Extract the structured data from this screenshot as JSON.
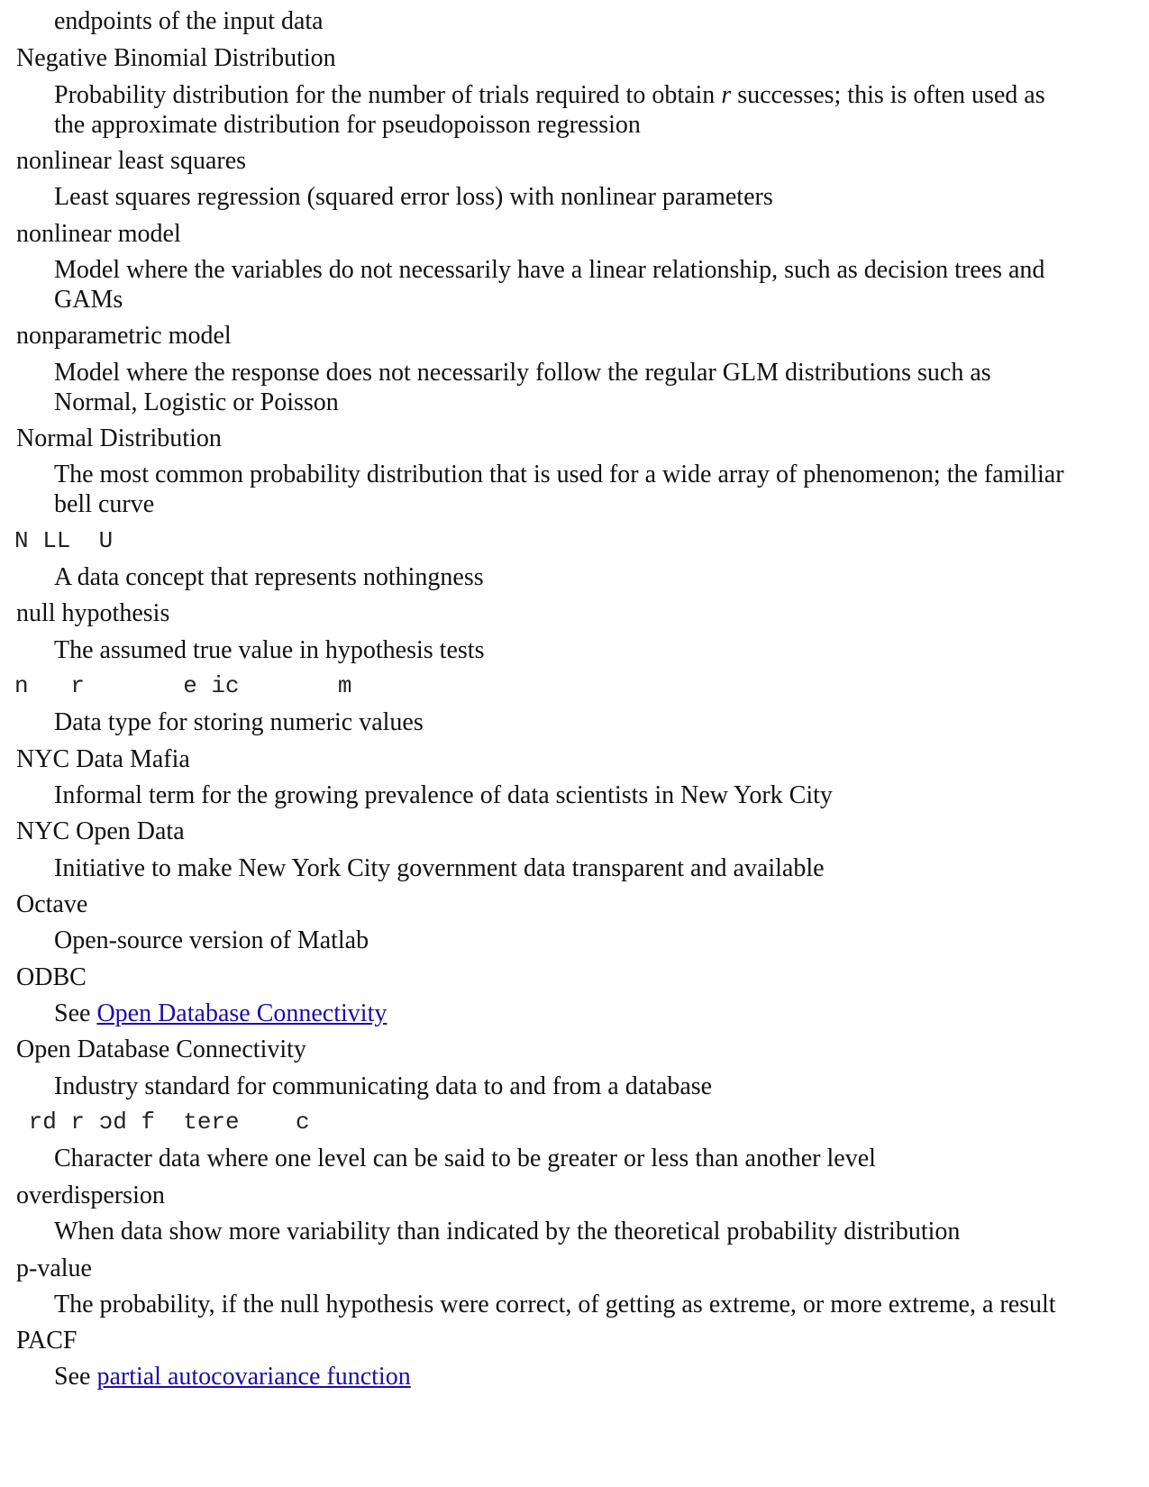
{
  "entries": [
    {
      "def": [
        "endpoints of the input data"
      ]
    },
    {
      "term": "Negative Binomial Distribution"
    },
    {
      "def_parts": [
        "Probability distribution for the number of trials required to obtain ",
        "r",
        " successes; this is often used as"
      ],
      "def2": "the approximate distribution for pseudopoisson regression"
    },
    {
      "term": "nonlinear least squares",
      "def": "Least squares regression (squared error loss) with nonlinear parameters"
    },
    {
      "term": "nonlinear model",
      "def1": "Model where the variables do not necessarily have a linear relationship, such as decision trees and",
      "def2": "GAMs"
    },
    {
      "term": "nonparametric model",
      "def1": "Model where the response does not necessarily follow the regular GLM distributions such as",
      "def2": "Normal, Logistic or Poisson"
    },
    {
      "term": "Normal Distribution",
      "def1": "The most common probability distribution that is used for a wide array of phenomenon; the familiar",
      "def2": "bell curve"
    },
    {
      "term": "N LL  U",
      "def": "A data concept that represents nothingness"
    },
    {
      "term": "null hypothesis",
      "def": "The assumed true value in hypothesis tests"
    },
    {
      "term": "n   r       e ic       m",
      "def": "Data type for storing numeric values"
    },
    {
      "term": "NYC Data Mafia",
      "def": "Informal term for the growing prevalence of data scientists in New York City"
    },
    {
      "term": "NYC Open Data",
      "def": "Initiative to make New York City government data transparent and available"
    },
    {
      "term": "Octave",
      "def": "Open-source version of Matlab"
    },
    {
      "term": "ODBC",
      "def_prefix": "See ",
      "def_link": "Open Database Connectivity"
    },
    {
      "term": "Open Database Connectivity",
      "def": "Industry standard for communicating data to and from a database"
    },
    {
      "term": "rd r ɔd f  tere    c",
      "def": "Character data where one level can be said to be greater or less than another level"
    },
    {
      "term": "overdispersion",
      "def": "When data show more variability than indicated by the theoretical probability distribution"
    },
    {
      "term": "p-value",
      "def": "The probability, if the null hypothesis were correct, of getting as extreme, or more extreme, a result"
    },
    {
      "term": "PACF",
      "def_prefix": "See ",
      "def_link": "partial autocovariance function"
    }
  ],
  "t": {
    "l0": "endpoints of the input data",
    "l1": "Negative Binomial Distribution",
    "l2a": "Probability distribution for the number of trials required to obtain ",
    "l2b": "r",
    "l2c": " successes; this is often used as",
    "l3": "the approximate distribution for pseudopoisson regression",
    "l4": "nonlinear least squares",
    "l5": "Least squares regression (squared error loss) with nonlinear parameters",
    "l6": "nonlinear model",
    "l7": "Model where the variables do not necessarily have a linear relationship, such as decision trees and",
    "l8": "GAMs",
    "l9": "nonparametric model",
    "l10": "Model where the response does not necessarily follow the regular GLM distributions such as",
    "l11": "Normal, Logistic or Poisson",
    "l12": "Normal Distribution",
    "l13": "The most common probability distribution that is used for a wide array of phenomenon; the familiar",
    "l14": "bell curve",
    "l15": "N LL  U",
    "l16": "A data concept that represents nothingness",
    "l17": "null hypothesis",
    "l18": "The assumed true value in hypothesis tests",
    "l19": "n   r       e ic       m",
    "l20": "Data type for storing numeric values",
    "l21": "NYC Data Mafia",
    "l22": "Informal term for the growing prevalence of data scientists in New York City",
    "l23": "NYC Open Data",
    "l24": "Initiative to make New York City government data transparent and available",
    "l25": "Octave",
    "l26": "Open-source version of Matlab",
    "l27": "ODBC",
    "l28a": "See ",
    "l28b": "Open Database Connectivity",
    "l29": "Open Database Connectivity",
    "l30": "Industry standard for communicating data to and from a database",
    "l31": " rd r ɔd f  tere    c",
    "l32": "Character data where one level can be said to be greater or less than another level",
    "l33": "overdispersion",
    "l34": "When data show more variability than indicated by the theoretical probability distribution",
    "l35": "p-value",
    "l36": "The probability, if the null hypothesis were correct, of getting as extreme, or more extreme, a result",
    "l37": "PACF",
    "l38a": "See ",
    "l38b": "partial autocovariance function"
  }
}
